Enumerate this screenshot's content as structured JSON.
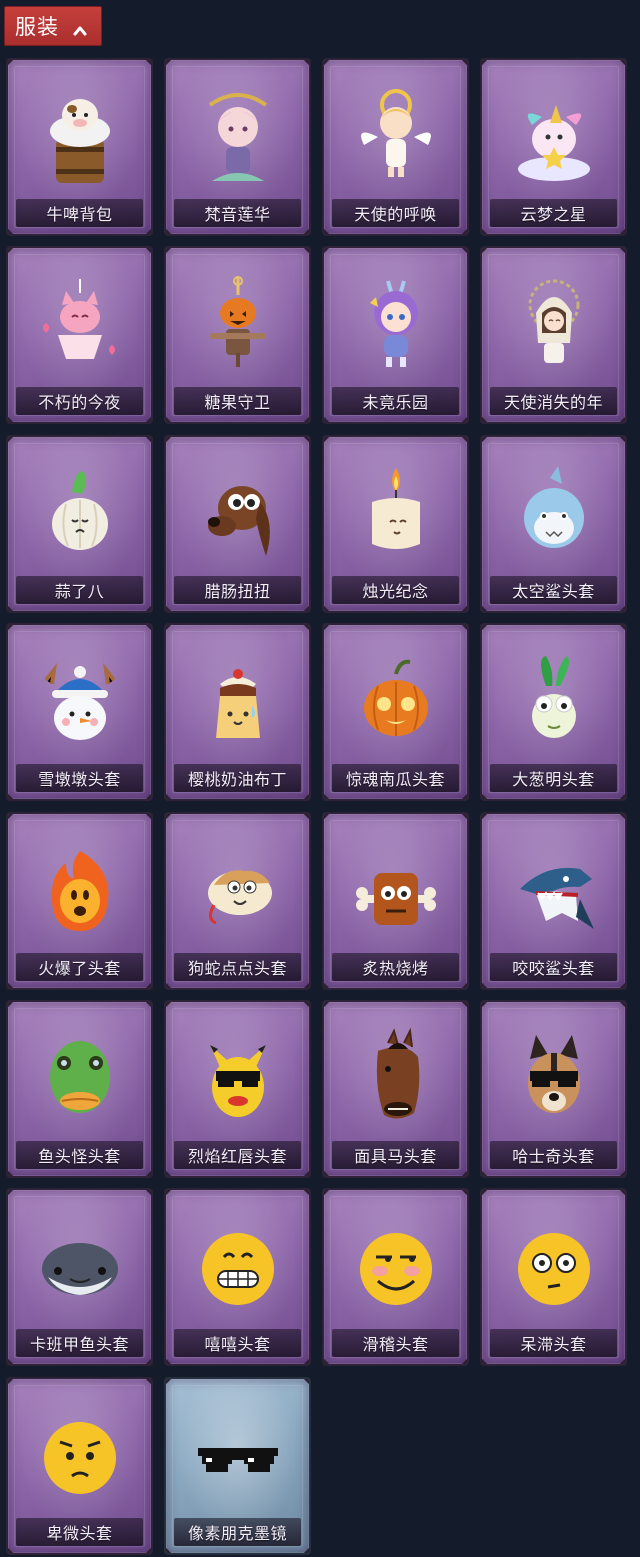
{
  "header": {
    "category_label": "服装",
    "chevron_icon": "chevron-up-icon",
    "accent_color": "#b8332f"
  },
  "items": [
    {
      "label": "牛啤背包",
      "icon": "cow-beer-backpack-icon",
      "rarity": "purple"
    },
    {
      "label": "梵音莲华",
      "icon": "lotus-character-icon",
      "rarity": "purple"
    },
    {
      "label": "天使的呼唤",
      "icon": "angel-character-icon",
      "rarity": "purple"
    },
    {
      "label": "云梦之星",
      "icon": "unicorn-cloud-icon",
      "rarity": "purple"
    },
    {
      "label": "不朽的今夜",
      "icon": "pink-fox-icon",
      "rarity": "purple"
    },
    {
      "label": "糖果守卫",
      "icon": "pumpkin-scarecrow-icon",
      "rarity": "purple"
    },
    {
      "label": "未竟乐园",
      "icon": "purple-hair-girl-icon",
      "rarity": "purple"
    },
    {
      "label": "天使消失的年",
      "icon": "halo-girl-icon",
      "rarity": "purple"
    },
    {
      "label": "蒜了八",
      "icon": "garlic-head-icon",
      "rarity": "purple"
    },
    {
      "label": "腊肠扭扭",
      "icon": "dachshund-head-icon",
      "rarity": "purple"
    },
    {
      "label": "烛光纪念",
      "icon": "candle-head-icon",
      "rarity": "purple"
    },
    {
      "label": "太空鲨头套",
      "icon": "space-shark-head-icon",
      "rarity": "purple"
    },
    {
      "label": "雪墩墩头套",
      "icon": "snowman-head-icon",
      "rarity": "purple"
    },
    {
      "label": "樱桃奶油布丁",
      "icon": "pudding-head-icon",
      "rarity": "purple"
    },
    {
      "label": "惊魂南瓜头套",
      "icon": "pumpkin-head-icon",
      "rarity": "purple"
    },
    {
      "label": "大葱明头套",
      "icon": "scallion-head-icon",
      "rarity": "purple"
    },
    {
      "label": "火爆了头套",
      "icon": "fireball-head-icon",
      "rarity": "purple"
    },
    {
      "label": "狗蛇点点头套",
      "icon": "dog-snake-head-icon",
      "rarity": "purple"
    },
    {
      "label": "炙热烧烤",
      "icon": "bbq-meat-head-icon",
      "rarity": "purple"
    },
    {
      "label": "咬咬鲨头套",
      "icon": "biting-shark-head-icon",
      "rarity": "purple"
    },
    {
      "label": "鱼头怪头套",
      "icon": "fish-monster-head-icon",
      "rarity": "purple"
    },
    {
      "label": "烈焰红唇头套",
      "icon": "red-lips-head-icon",
      "rarity": "purple"
    },
    {
      "label": "面具马头套",
      "icon": "horse-mask-icon",
      "rarity": "purple"
    },
    {
      "label": "哈士奇头套",
      "icon": "husky-head-icon",
      "rarity": "purple"
    },
    {
      "label": "卡班甲鱼头套",
      "icon": "whale-head-icon",
      "rarity": "purple"
    },
    {
      "label": "嘻嘻头套",
      "icon": "grin-emoji-head-icon",
      "rarity": "purple"
    },
    {
      "label": "滑稽头套",
      "icon": "smirk-emoji-head-icon",
      "rarity": "purple"
    },
    {
      "label": "呆滞头套",
      "icon": "dazed-emoji-head-icon",
      "rarity": "purple"
    },
    {
      "label": "卑微头套",
      "icon": "humble-emoji-head-icon",
      "rarity": "purple"
    },
    {
      "label": "像素朋克墨镜",
      "icon": "pixel-sunglasses-icon",
      "rarity": "blue"
    }
  ]
}
